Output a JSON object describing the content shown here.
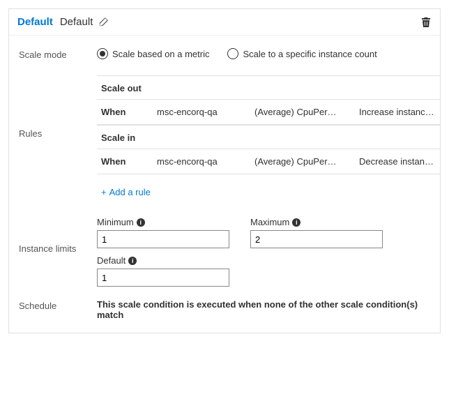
{
  "header": {
    "title_active": "Default",
    "title_editable": "Default"
  },
  "scale_mode": {
    "label": "Scale mode",
    "options": {
      "metric": "Scale based on a metric",
      "fixed": "Scale to a specific instance count"
    }
  },
  "rules": {
    "label": "Rules",
    "scale_out_header": "Scale out",
    "scale_in_header": "Scale in",
    "when_label": "When",
    "scale_out": {
      "resource": "msc-encorq-qa",
      "metric": "(Average) CpuPer…",
      "action": "Increase instance…"
    },
    "scale_in": {
      "resource": "msc-encorq-qa",
      "metric": "(Average) CpuPer…",
      "action": "Decrease instance."
    },
    "add_rule_label": "Add a rule"
  },
  "instance_limits": {
    "label": "Instance limits",
    "minimum_label": "Minimum",
    "maximum_label": "Maximum",
    "default_label": "Default",
    "minimum_value": "1",
    "maximum_value": "2",
    "default_value": "1"
  },
  "schedule": {
    "label": "Schedule",
    "text": "This scale condition is executed when none of the other scale condition(s) match"
  }
}
